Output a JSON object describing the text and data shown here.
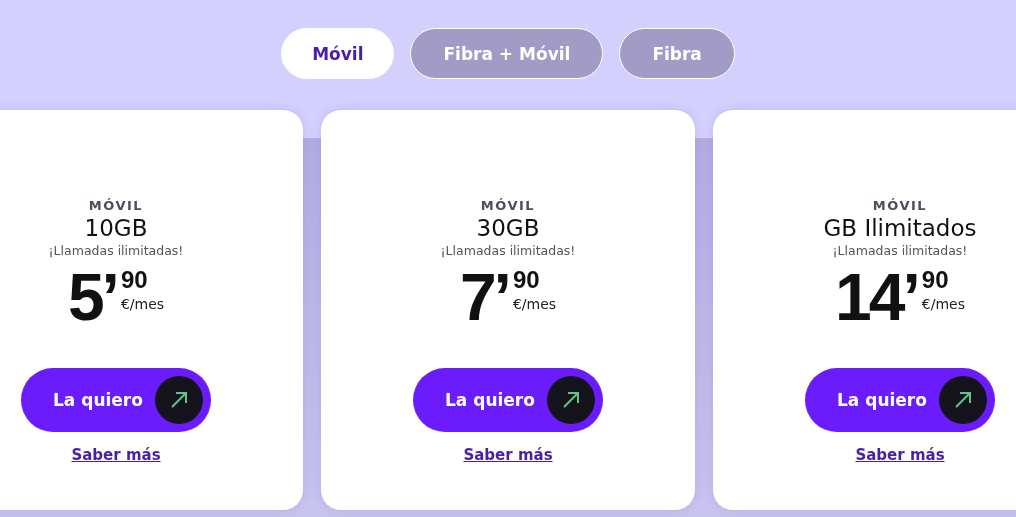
{
  "tabs": [
    {
      "label": "Móvil",
      "selected": true
    },
    {
      "label": "Fibra + Móvil",
      "selected": false
    },
    {
      "label": "Fibra",
      "selected": false
    }
  ],
  "plans": [
    {
      "category": "MÓVIL",
      "data": "10GB",
      "subtitle": "¡Llamadas ilimitadas!",
      "price_main": "5’",
      "price_cents": "90",
      "price_unit": "€/mes",
      "cta": "La quiero",
      "link": "Saber más"
    },
    {
      "category": "MÓVIL",
      "data": "30GB",
      "subtitle": "¡Llamadas ilimitadas!",
      "price_main": "7’",
      "price_cents": "90",
      "price_unit": "€/mes",
      "cta": "La quiero",
      "link": "Saber más"
    },
    {
      "category": "MÓVIL",
      "data": "GB Ilimitados",
      "subtitle": "¡Llamadas ilimitadas!",
      "price_main": "14’",
      "price_cents": "90",
      "price_unit": "€/mes",
      "cta": "La quiero",
      "link": "Saber más"
    }
  ]
}
